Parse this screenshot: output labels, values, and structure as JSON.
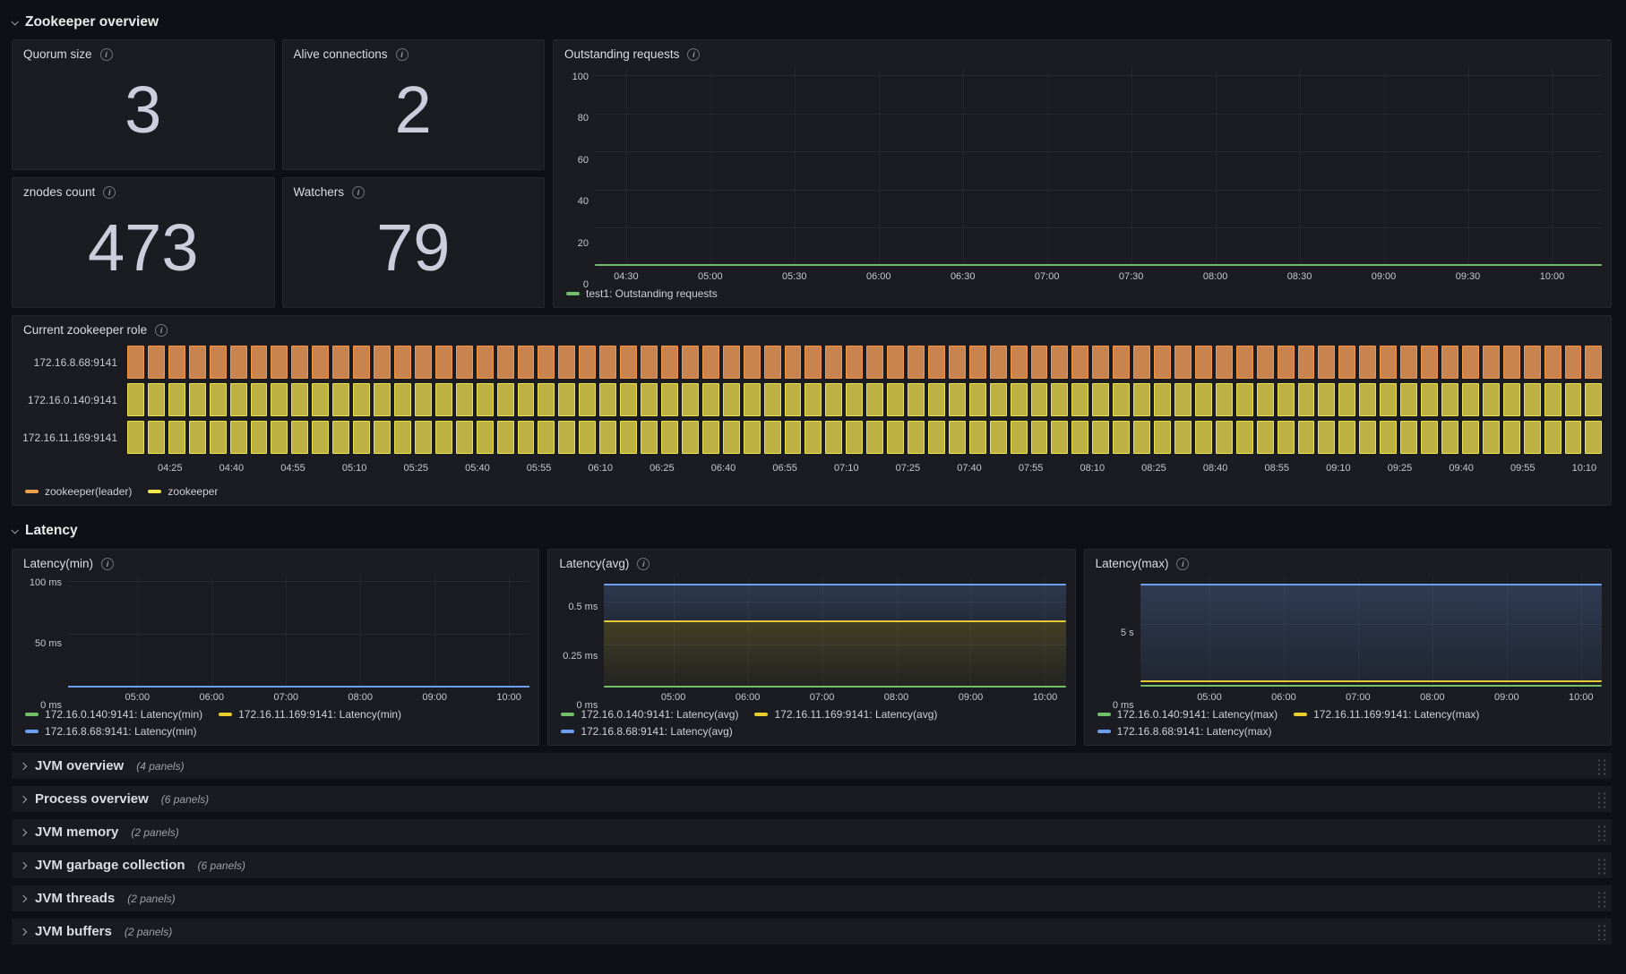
{
  "sections": {
    "zookeeper_overview": {
      "title": "Zookeeper overview"
    },
    "latency": {
      "title": "Latency"
    }
  },
  "stat_panels": [
    {
      "title": "Quorum size",
      "value": "3"
    },
    {
      "title": "Alive connections",
      "value": "2"
    },
    {
      "title": "znodes count",
      "value": "473"
    },
    {
      "title": "Watchers",
      "value": "79"
    }
  ],
  "panels": {
    "outstanding_requests": {
      "title": "Outstanding requests",
      "legend": [
        {
          "label": "test1: Outstanding requests",
          "color": "#73bf69"
        }
      ],
      "chart_data": {
        "type": "line",
        "title": "Outstanding requests",
        "ylim": [
          0,
          104
        ],
        "y_ticks": [
          {
            "label": "0",
            "pos": 0
          },
          {
            "label": "20",
            "pos": 19.2
          },
          {
            "label": "40",
            "pos": 38.4
          },
          {
            "label": "60",
            "pos": 57.6
          },
          {
            "label": "80",
            "pos": 76.8
          },
          {
            "label": "100",
            "pos": 96
          }
        ],
        "x_ticks": [
          "04:30",
          "05:00",
          "05:30",
          "06:00",
          "06:30",
          "07:00",
          "07:30",
          "08:00",
          "08:30",
          "09:00",
          "09:30",
          "10:00"
        ],
        "x_first_pos": 3.1,
        "x_step_pos": 8.36,
        "series": [
          {
            "name": "test1: Outstanding requests",
            "color": "#73bf69",
            "value": 0,
            "pos": 0.9
          }
        ]
      }
    },
    "current_role": {
      "title": "Current zookeeper role",
      "legend": [
        {
          "label": "zookeeper(leader)",
          "color": "#eda04f"
        },
        {
          "label": "zookeeper",
          "color": "#f2e64a"
        }
      ],
      "chart_data": {
        "type": "status-history",
        "title": "Current zookeeper role",
        "rows": [
          {
            "label": "172.16.8.68:9141",
            "state": "zookeeper(leader)"
          },
          {
            "label": "172.16.0.140:9141",
            "state": "zookeeper"
          },
          {
            "label": "172.16.11.169:9141",
            "state": "zookeeper"
          }
        ],
        "state_colors": {
          "zookeeper(leader)": {
            "fill": "#c8834e",
            "border": "#f79540"
          },
          "zookeeper": {
            "fill": "#bdb144",
            "border": "#ece24e"
          }
        },
        "bar_count": 72,
        "x_ticks": [
          "04:25",
          "04:40",
          "04:55",
          "05:10",
          "05:25",
          "05:40",
          "05:55",
          "06:10",
          "06:25",
          "06:40",
          "06:55",
          "07:10",
          "07:25",
          "07:40",
          "07:55",
          "08:10",
          "08:25",
          "08:40",
          "08:55",
          "09:10",
          "09:25",
          "09:40",
          "09:55",
          "10:10"
        ],
        "x_first_pos": 2.9,
        "x_step_pos": 4.17
      }
    },
    "latency_min": {
      "title": "Latency(min)",
      "legend": [
        {
          "label": "172.16.0.140:9141: Latency(min)",
          "color": "#73bf69"
        },
        {
          "label": "172.16.11.169:9141: Latency(min)",
          "color": "#eace2e"
        },
        {
          "label": "172.16.8.68:9141: Latency(min)",
          "color": "#6e9fef"
        }
      ],
      "chart_data": {
        "type": "line",
        "title": "Latency(min)",
        "ylim_label": "0 ms - 100 ms",
        "y_ticks": [
          {
            "label": "0 ms",
            "pos": 0
          },
          {
            "label": "50 ms",
            "pos": 48
          },
          {
            "label": "100 ms",
            "pos": 96
          }
        ],
        "x_ticks": [
          "05:00",
          "06:00",
          "07:00",
          "08:00",
          "09:00",
          "10:00"
        ],
        "x_first_pos": 15,
        "x_step_pos": 16.1,
        "series": [
          {
            "name": "172.16.0.140:9141: Latency(min)",
            "color": "#73bf69",
            "value": "0 ms",
            "pos": 0.9
          },
          {
            "name": "172.16.11.169:9141: Latency(min)",
            "color": "#eace2e",
            "value": "0 ms",
            "pos": 0.9
          },
          {
            "name": "172.16.8.68:9141: Latency(min)",
            "color": "#6e9fef",
            "value": "0 ms",
            "pos": 1.2
          }
        ]
      }
    },
    "latency_avg": {
      "title": "Latency(avg)",
      "legend": [
        {
          "label": "172.16.0.140:9141: Latency(avg)",
          "color": "#73bf69"
        },
        {
          "label": "172.16.11.169:9141: Latency(avg)",
          "color": "#eace2e"
        },
        {
          "label": "172.16.8.68:9141: Latency(avg)",
          "color": "#6e9fef"
        }
      ],
      "chart_data": {
        "type": "line",
        "title": "Latency(avg)",
        "ylim_label": "0 ms - 0.65 ms",
        "y_ticks": [
          {
            "label": "0 ms",
            "pos": 0
          },
          {
            "label": "0.25 ms",
            "pos": 38.5
          },
          {
            "label": "0.5 ms",
            "pos": 77
          }
        ],
        "x_ticks": [
          "05:00",
          "06:00",
          "07:00",
          "08:00",
          "09:00",
          "10:00"
        ],
        "x_first_pos": 15,
        "x_step_pos": 16.1,
        "series": [
          {
            "name": "172.16.0.140:9141: Latency(avg)",
            "color": "#73bf69",
            "value": "0 ms",
            "pos": 1
          },
          {
            "name": "172.16.11.169:9141: Latency(avg)",
            "color": "#eace2e",
            "value": "0.39 ms",
            "pos": 60,
            "fill": {
              "to_pos": 1,
              "from": "rgba(234,206,46,0.20)",
              "to": "rgba(234,206,46,0.04)"
            }
          },
          {
            "name": "172.16.8.68:9141: Latency(avg)",
            "color": "#6e9fef",
            "value": "0.61 ms",
            "pos": 93.5,
            "fill": {
              "to_pos": 60,
              "from": "rgba(110,159,239,0.22)",
              "to": "rgba(110,159,239,0.12)"
            }
          }
        ]
      }
    },
    "latency_max": {
      "title": "Latency(max)",
      "legend": [
        {
          "label": "172.16.0.140:9141: Latency(max)",
          "color": "#73bf69"
        },
        {
          "label": "172.16.11.169:9141: Latency(max)",
          "color": "#eace2e"
        },
        {
          "label": "172.16.8.68:9141: Latency(max)",
          "color": "#6e9fef"
        }
      ],
      "chart_data": {
        "type": "line",
        "title": "Latency(max)",
        "ylim_label": "0 ms - 8.8 s",
        "y_ticks": [
          {
            "label": "0 ms",
            "pos": 0
          },
          {
            "label": "5 s",
            "pos": 57
          }
        ],
        "x_ticks": [
          "05:00",
          "06:00",
          "07:00",
          "08:00",
          "09:00",
          "10:00"
        ],
        "x_first_pos": 15,
        "x_step_pos": 16.1,
        "series": [
          {
            "name": "172.16.0.140:9141: Latency(max)",
            "color": "#73bf69",
            "value": "0.05 s",
            "pos": 1.3
          },
          {
            "name": "172.16.11.169:9141: Latency(max)",
            "color": "#eace2e",
            "value": "0.45 s",
            "pos": 5.5
          },
          {
            "name": "172.16.8.68:9141: Latency(max)",
            "color": "#6e9fef",
            "value": "8.2 s",
            "pos": 93.5,
            "fill": {
              "to_pos": 5.5,
              "from": "rgba(110,159,239,0.24)",
              "to": "rgba(110,159,239,0.08)"
            }
          }
        ]
      }
    }
  },
  "collapsed_rows": [
    {
      "title": "JVM overview",
      "count": "(4 panels)"
    },
    {
      "title": "Process overview",
      "count": "(6 panels)"
    },
    {
      "title": "JVM memory",
      "count": "(2 panels)"
    },
    {
      "title": "JVM garbage collection",
      "count": "(6 panels)"
    },
    {
      "title": "JVM threads",
      "count": "(2 panels)"
    },
    {
      "title": "JVM buffers",
      "count": "(2 panels)"
    }
  ]
}
